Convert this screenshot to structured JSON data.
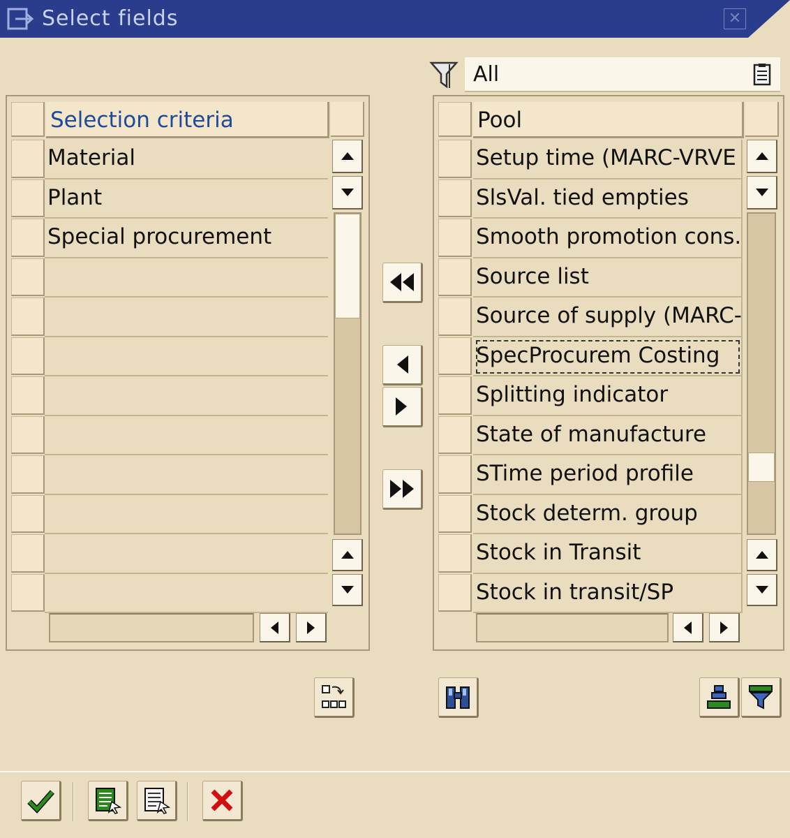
{
  "window": {
    "title": "Select fields"
  },
  "filter": {
    "value": "All"
  },
  "left_table": {
    "header": "Selection criteria",
    "rows": [
      "Material",
      "Plant",
      "Special procurement",
      "",
      "",
      "",
      "",
      "",
      "",
      "",
      "",
      ""
    ]
  },
  "right_table": {
    "header": "Pool",
    "rows": [
      "Setup time (MARC-VRVE",
      "SlsVal. tied empties",
      "Smooth promotion cons.",
      "Source list",
      "Source of supply (MARC-",
      "SpecProcurem Costing",
      "Splitting indicator",
      "State of manufacture",
      "STime period profile",
      "Stock determ. group",
      "Stock in Transit",
      "Stock in transit/SP"
    ],
    "focused_row": "SpecProcurem Costing"
  },
  "colors": {
    "title_bar": "#2a3c8c",
    "background": "#eadcbf",
    "header_text": "#1f4a9a",
    "cancel_red": "#d01010",
    "confirm_green": "#2a8a1a"
  }
}
